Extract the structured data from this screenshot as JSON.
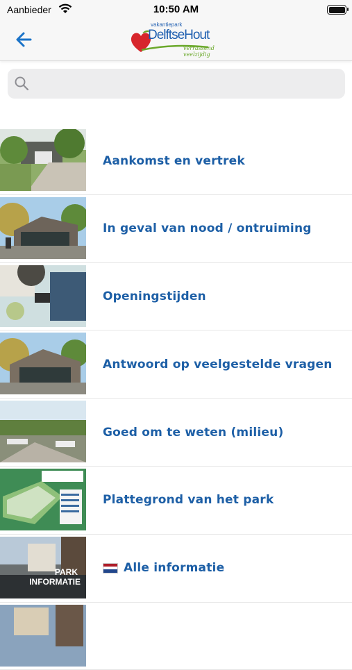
{
  "status": {
    "carrier": "Aanbieder",
    "time": "10:50 AM"
  },
  "header": {
    "logo_sub": "vakantiepark",
    "logo_name": "DelftseHout",
    "logo_tag": "verrassend veelzijdig"
  },
  "search": {
    "placeholder": ""
  },
  "colors": {
    "accent": "#1d5fa6",
    "logo_red": "#d7262c",
    "logo_green": "#6aa82a"
  },
  "items": [
    {
      "label": "Aankomst en vertrek",
      "thumb": "camping-road-photo"
    },
    {
      "label": "In geval van nood / ontruiming",
      "thumb": "cabin-photo"
    },
    {
      "label": "Openingstijden",
      "thumb": "table-items-photo"
    },
    {
      "label": "Antwoord op veelgestelde vragen",
      "thumb": "cabin-photo"
    },
    {
      "label": "Goed om te weten (milieu)",
      "thumb": "park-aerial-photo"
    },
    {
      "label": "Plattegrond van het park",
      "thumb": "park-map"
    },
    {
      "label": "Alle informatie",
      "thumb": "park-informatie-banner",
      "flag": "netherlands-flag",
      "banner_text_1": "PARK",
      "banner_text_2": "INFORMATIE"
    },
    {
      "label": "",
      "thumb": "town-photo"
    }
  ]
}
